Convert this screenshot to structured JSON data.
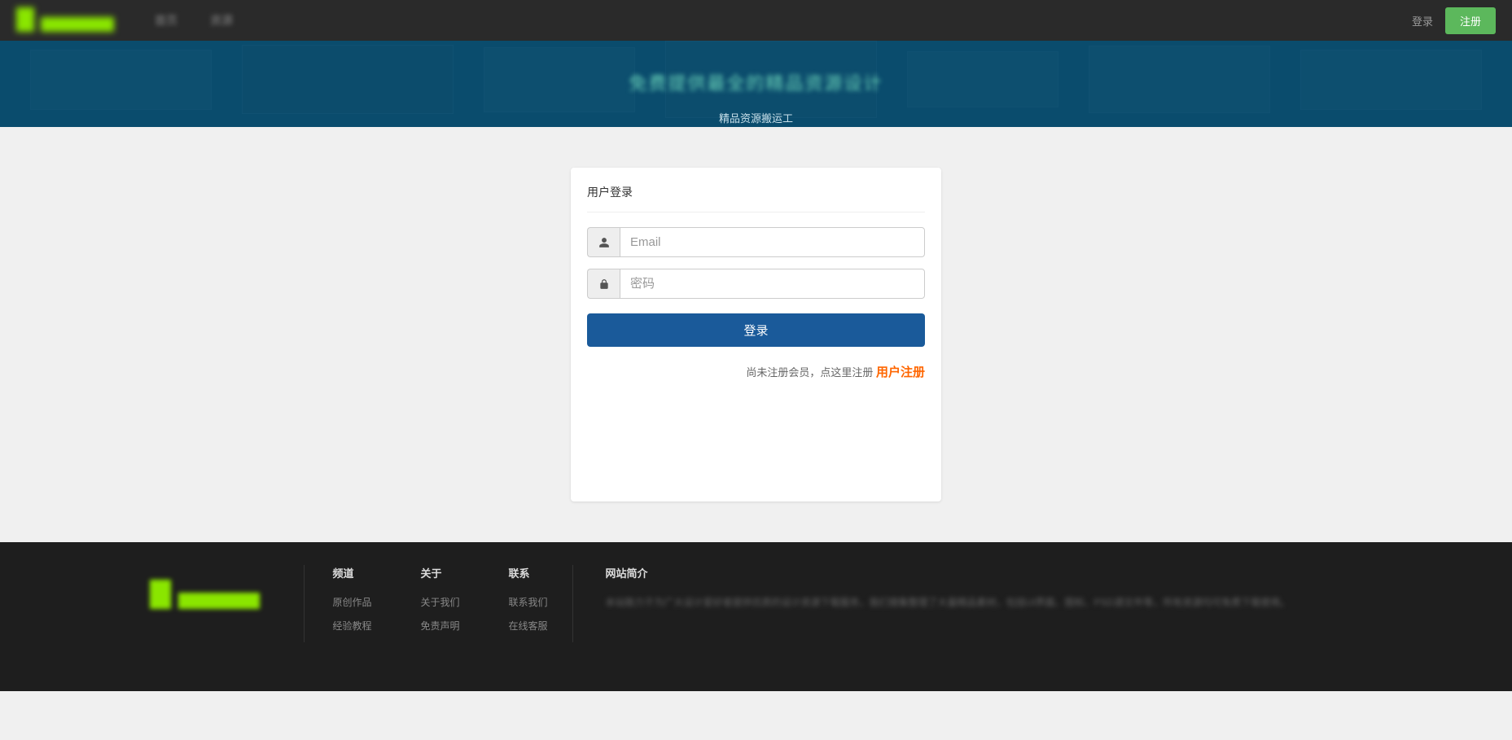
{
  "header": {
    "nav": [
      "首页",
      "资源"
    ],
    "login_label": "登录",
    "register_label": "注册"
  },
  "hero": {
    "title": "免费提供最全的精品资源设计",
    "subtitle": "精品资源搬运工"
  },
  "login": {
    "panel_title": "用户登录",
    "email_placeholder": "Email",
    "password_placeholder": "密码",
    "submit_label": "登录",
    "register_prefix": "尚未注册会员，点这里注册 ",
    "register_link": "用户注册"
  },
  "footer": {
    "col1": {
      "title": "频道",
      "items": [
        "原创作品",
        "经验教程"
      ]
    },
    "col2": {
      "title": "关于",
      "items": [
        "关于我们",
        "免责声明"
      ]
    },
    "col3": {
      "title": "联系",
      "items": [
        "联系我们",
        "在线客服"
      ]
    },
    "about": {
      "title": "网站简介",
      "text": "本站致力于为广大设计爱好者提供优质的设计资源下载服务，我们搜集整理了大量精品素材，包括UI界面、图标、PSD源文件等，所有资源均可免费下载使用。"
    }
  }
}
